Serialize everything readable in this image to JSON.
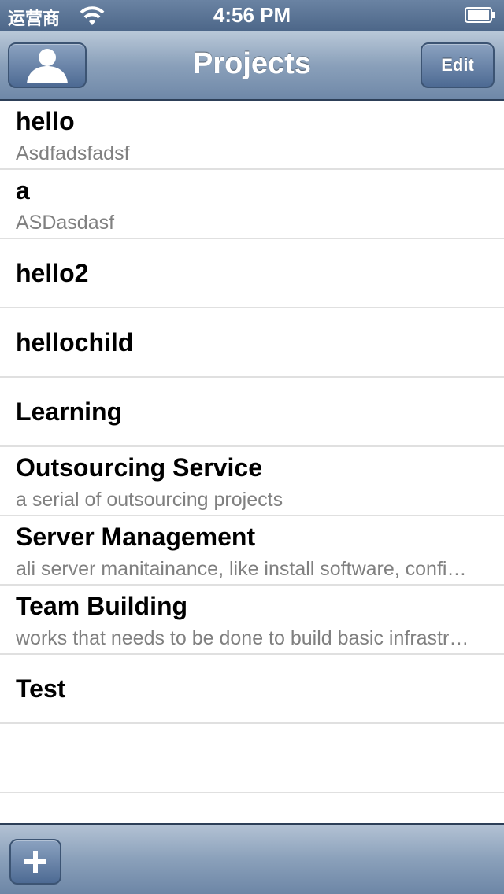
{
  "status_bar": {
    "carrier": "运营商",
    "time": "4:56 PM",
    "icons": [
      "wifi-icon",
      "battery-icon"
    ]
  },
  "nav": {
    "title": "Projects",
    "left_button_icon": "person-icon",
    "edit_label": "Edit"
  },
  "projects": [
    {
      "title": "hello",
      "subtitle": "Asdfadsfadsf"
    },
    {
      "title": "a",
      "subtitle": "ASDasdasf"
    },
    {
      "title": "hello2",
      "subtitle": ""
    },
    {
      "title": "hellochild",
      "subtitle": ""
    },
    {
      "title": "Learning",
      "subtitle": ""
    },
    {
      "title": "Outsourcing Service",
      "subtitle": "a serial of outsourcing projects"
    },
    {
      "title": "Server Management",
      "subtitle": "ali server manitainance, like install software, configuration"
    },
    {
      "title": "Team Building",
      "subtitle": "works that needs to be done to build basic infrastructure"
    },
    {
      "title": "Test",
      "subtitle": ""
    }
  ],
  "toolbar": {
    "add_icon": "plus-icon"
  },
  "colors": {
    "bar_top": "#b9c8d8",
    "bar_bottom": "#6f88a8",
    "separator": "#e0e0e0",
    "subtitle": "#808080"
  }
}
